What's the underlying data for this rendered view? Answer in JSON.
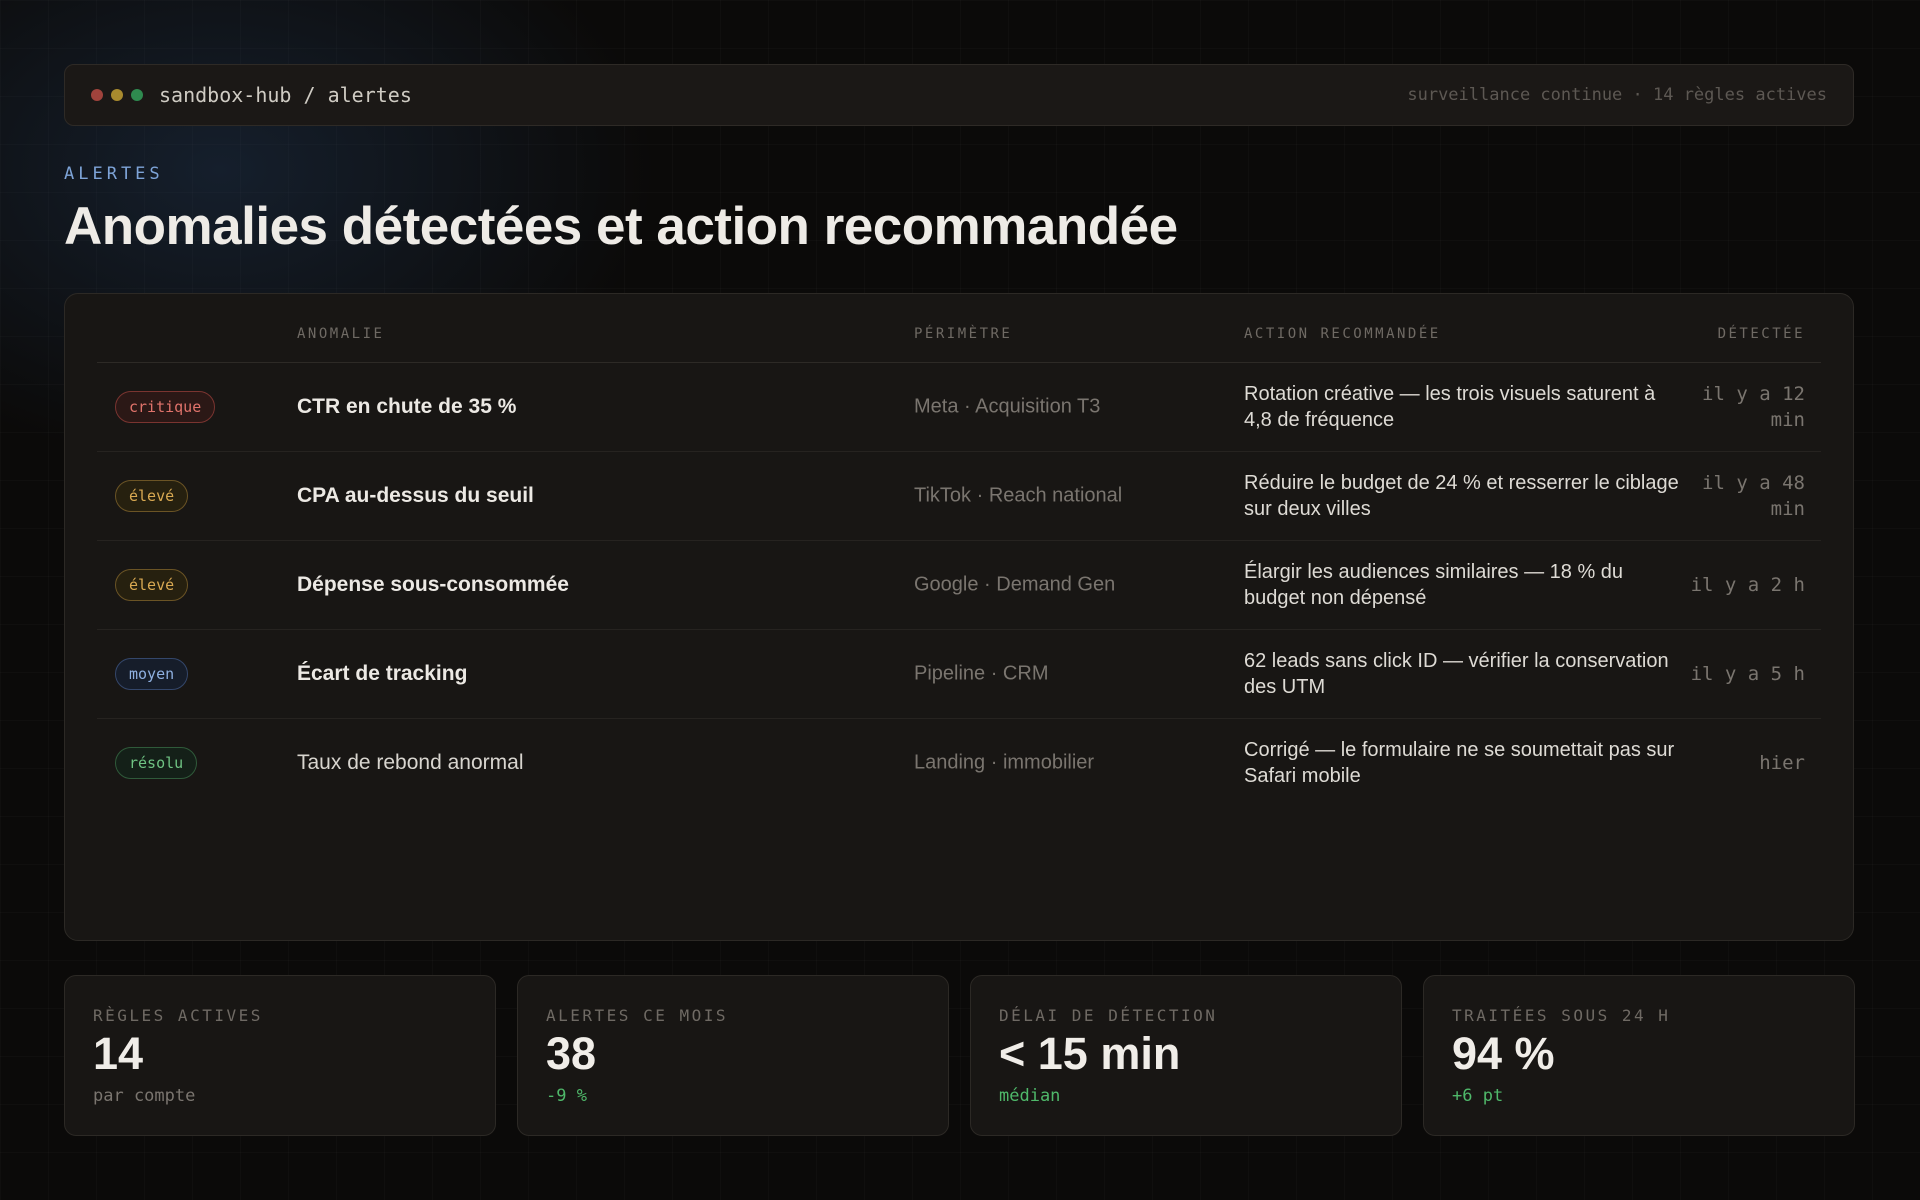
{
  "window": {
    "path": "sandbox-hub / alertes",
    "status": "surveillance continue · 14 règles actives",
    "dots": [
      "#a0433c",
      "#a88a2e",
      "#2f8a4f"
    ]
  },
  "header": {
    "eyebrow": "ALERTES",
    "title": "Anomalies détectées et action recommandée"
  },
  "table": {
    "columns": [
      "ANOMALIE",
      "PÉRIMÈTRE",
      "ACTION RECOMMANDÉE",
      "DÉTECTÉE"
    ],
    "rows": [
      {
        "severity": "critique",
        "anomaly": "CTR en chute de 35 %",
        "scope": "Meta · Acquisition T3",
        "action": "Rotation créative — les trois visuels saturent à 4,8 de fréquence",
        "detected": "il y a 12 min"
      },
      {
        "severity": "élevé",
        "anomaly": "CPA au-dessus du seuil",
        "scope": "TikTok · Reach national",
        "action": "Réduire le budget de 24 % et resserrer le ciblage sur deux villes",
        "detected": "il y a 48 min"
      },
      {
        "severity": "élevé",
        "anomaly": "Dépense sous-consommée",
        "scope": "Google · Demand Gen",
        "action": "Élargir les audiences similaires — 18 % du budget non dépensé",
        "detected": "il y a 2 h"
      },
      {
        "severity": "moyen",
        "anomaly": "Écart de tracking",
        "scope": "Pipeline · CRM",
        "action": "62 leads sans click ID — vérifier la conservation des UTM",
        "detected": "il y a 5 h"
      },
      {
        "severity": "résolu",
        "anomaly": "Taux de rebond anormal",
        "scope": "Landing · immobilier",
        "action": "Corrigé — le formulaire ne se soumettait pas sur Safari mobile",
        "detected": "hier"
      }
    ]
  },
  "severity_colors": {
    "critique": {
      "text": "#e0736b",
      "border": "#7a3430",
      "bg": "#2b1816"
    },
    "élevé": {
      "text": "#d9a952",
      "border": "#6b5425",
      "bg": "#26200f"
    },
    "moyen": {
      "text": "#8fb0e0",
      "border": "#34476b",
      "bg": "#161d2a"
    },
    "résolu": {
      "text": "#6fc383",
      "border": "#2f5a3a",
      "bg": "#142018"
    }
  },
  "kpis": [
    {
      "label": "RÈGLES ACTIVES",
      "value": "14",
      "sub": "par compte",
      "sub_color": "#7a756f"
    },
    {
      "label": "ALERTES CE MOIS",
      "value": "38",
      "sub": "-9 %",
      "sub_color": "#4fb86a"
    },
    {
      "label": "DÉLAI DE DÉTECTION",
      "value": "< 15 min",
      "sub": "médian",
      "sub_color": "#4fb86a"
    },
    {
      "label": "TRAITÉES SOUS 24 H",
      "value": "94 %",
      "sub": "+6 pt",
      "sub_color": "#4fb86a"
    }
  ]
}
